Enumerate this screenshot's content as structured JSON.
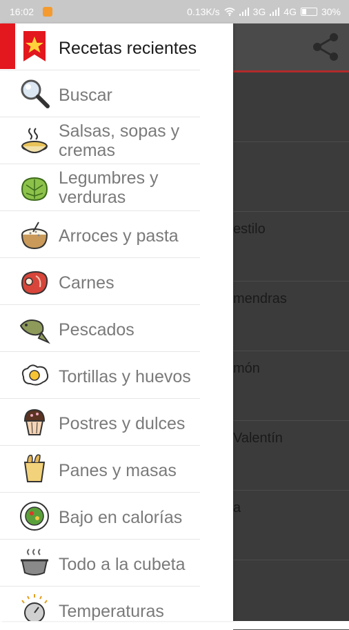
{
  "status": {
    "time": "16:02",
    "speed": "0.13K/s",
    "net1": "3G",
    "net2": "4G",
    "battery": "30%"
  },
  "drawer": {
    "items": [
      {
        "label": "Recetas recientes",
        "icon": "bookmark-star-icon"
      },
      {
        "label": "Buscar",
        "icon": "magnifier-icon"
      },
      {
        "label": "Salsas, sopas y cremas",
        "icon": "soup-bowl-icon"
      },
      {
        "label": "Legumbres y verduras",
        "icon": "lettuce-icon"
      },
      {
        "label": "Arroces y pasta",
        "icon": "rice-bowl-icon"
      },
      {
        "label": "Carnes",
        "icon": "steak-icon"
      },
      {
        "label": "Pescados",
        "icon": "fish-icon"
      },
      {
        "label": "Tortillas y huevos",
        "icon": "fried-egg-icon"
      },
      {
        "label": "Postres y dulces",
        "icon": "muffin-icon"
      },
      {
        "label": "Panes y masas",
        "icon": "bread-bag-icon"
      },
      {
        "label": "Bajo en calorías",
        "icon": "salad-plate-icon"
      },
      {
        "label": "Todo a la cubeta",
        "icon": "steam-pot-icon"
      },
      {
        "label": "Temperaturas",
        "icon": "gauge-icon"
      }
    ]
  },
  "background_list": {
    "rows": [
      "estilo",
      "mendras",
      "món",
      "Valentín",
      "a"
    ]
  },
  "colors": {
    "accent_red": "#e3171e",
    "toolbar_underline": "#b32a2a"
  }
}
